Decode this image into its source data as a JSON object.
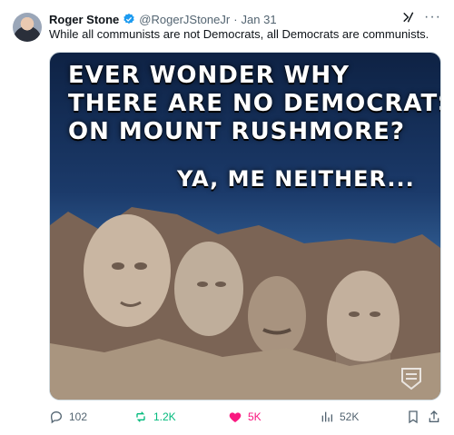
{
  "tweet": {
    "author_name": "Roger Stone",
    "handle": "@RogerJStoneJr",
    "dot": "·",
    "date": "Jan 31",
    "text": "While all communists are not Democrats, all Democrats are communists.",
    "more": "···",
    "meme": {
      "line1": "EVER WONDER WHY",
      "line2": "THERE ARE NO DEMOCRATS",
      "line3": "ON MOUNT RUSHMORE?",
      "line4": "YA, ME NEITHER..."
    }
  },
  "actions": {
    "replies": "102",
    "reposts": "1.2K",
    "likes": "5K",
    "views": "52K"
  },
  "colors": {
    "verified": "#1d9bf0",
    "repost": "#00ba7c",
    "like": "#f91880",
    "muted": "#536471"
  },
  "icons": [
    "verified-badge-icon",
    "grok-icon",
    "more-icon",
    "reply-icon",
    "repost-icon",
    "like-icon",
    "views-icon",
    "bookmark-icon",
    "share-icon"
  ]
}
